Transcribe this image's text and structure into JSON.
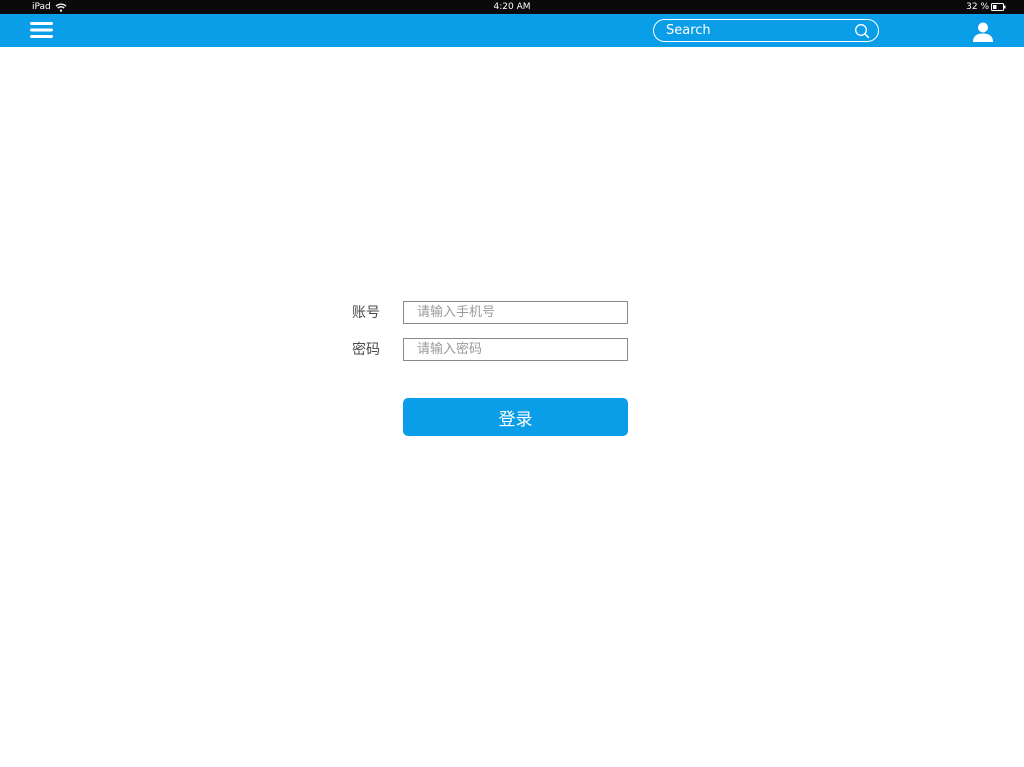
{
  "status_bar": {
    "device": "iPad",
    "time": "4:20 AM",
    "battery": "32 %"
  },
  "nav": {
    "search_placeholder": "Search",
    "icons": {
      "menu": "hamburger-menu-icon",
      "search": "search-icon",
      "user": "user-icon"
    }
  },
  "login": {
    "account_label": "账号",
    "account_placeholder": "请输入手机号",
    "password_label": "密码",
    "password_placeholder": "请输入密码",
    "submit_label": "登录"
  },
  "colors": {
    "accent": "#0a9de8",
    "status_bar_bg": "#0a0a0a"
  }
}
